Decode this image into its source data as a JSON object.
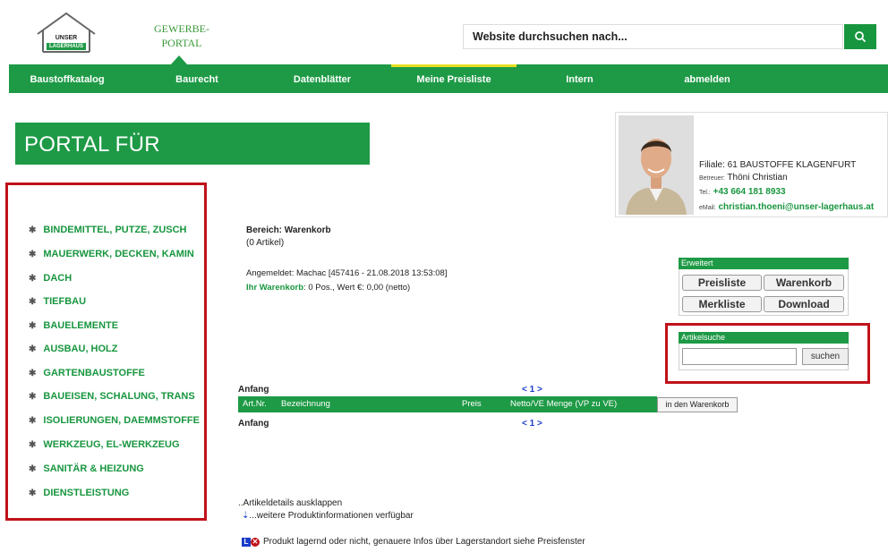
{
  "header": {
    "logo_line1": "UNSER",
    "logo_line2": "LAGERHAUS",
    "portal_line1": "GEWERBE-",
    "portal_line2": "PORTAL",
    "search_placeholder": "Website durchsuchen nach...",
    "search_icon": "search-icon"
  },
  "nav": {
    "items": [
      "Baustoffkatalog",
      "Baurecht",
      "Datenblätter",
      "Meine Preisliste",
      "Intern",
      "abmelden"
    ],
    "active": "Meine Preisliste",
    "active_color": "#e6e01f"
  },
  "page_title": "PORTAL FÜR GEWERBEKUNDEN",
  "contact": {
    "filiale": "Filiale: 61 BAUSTOFFE KLAGENFURT",
    "betreuer_label": "Betreuer:",
    "betreuer_name": "Thöni Christian",
    "tel_label": "Tel.:",
    "tel": "+43 664 181 8933",
    "email_label": "eMail:",
    "email": "christian.thoeni@unser-lagerhaus.at"
  },
  "categories": [
    "BINDEMITTEL, PUTZE, ZUSCH",
    "MAUERWERK, DECKEN, KAMIN",
    "DACH",
    "TIEFBAU",
    "BAUELEMENTE",
    "AUSBAU, HOLZ",
    "GARTENBAUSTOFFE",
    "BAUEISEN, SCHALUNG, TRANS",
    "ISOLIERUNGEN, DAEMMSTOFFE",
    "WERKZEUG, EL-WERKZEUG",
    "SANITÄR & HEIZUNG",
    "DIENSTLEISTUNG"
  ],
  "cart": {
    "bereich": "Bereich: Warenkorb",
    "artikel": "(0 Artikel)",
    "angemeldet": "Angemeldet: Machac [457416 - 21.08.2018 13:53:08]",
    "warenkorb_label": "Ihr Warenkorb",
    "warenkorb_value": ": 0 Pos., Wert €: 0,00 (netto)"
  },
  "erweitert": {
    "title": "Erweitert",
    "buttons": [
      "Preisliste",
      "Warenkorb",
      "Merkliste",
      "Download"
    ]
  },
  "artikelsuche": {
    "title": "Artikelsuche",
    "input_value": "",
    "button": "suchen"
  },
  "table": {
    "top_label": "Anfang",
    "bottom_label": "Anfang",
    "pager": "< 1 >",
    "columns": [
      "Art.Nr.",
      "Bezeichnung",
      "Preis",
      "Netto/VE Menge (VP zu VE)"
    ],
    "add_button": "in den Warenkorb"
  },
  "footer_notes": {
    "details": "..Artikeldetails ausklappen",
    "weitere": "...weitere Produktinformationen verfügbar",
    "lager": "Produkt lagernd oder nicht, genauere Infos über Lagerstandort siehe Preisfenster"
  },
  "colors": {
    "brand_green": "#1e9a46",
    "highlight_red": "#c0121a",
    "link_blue": "#1a3cc8"
  }
}
